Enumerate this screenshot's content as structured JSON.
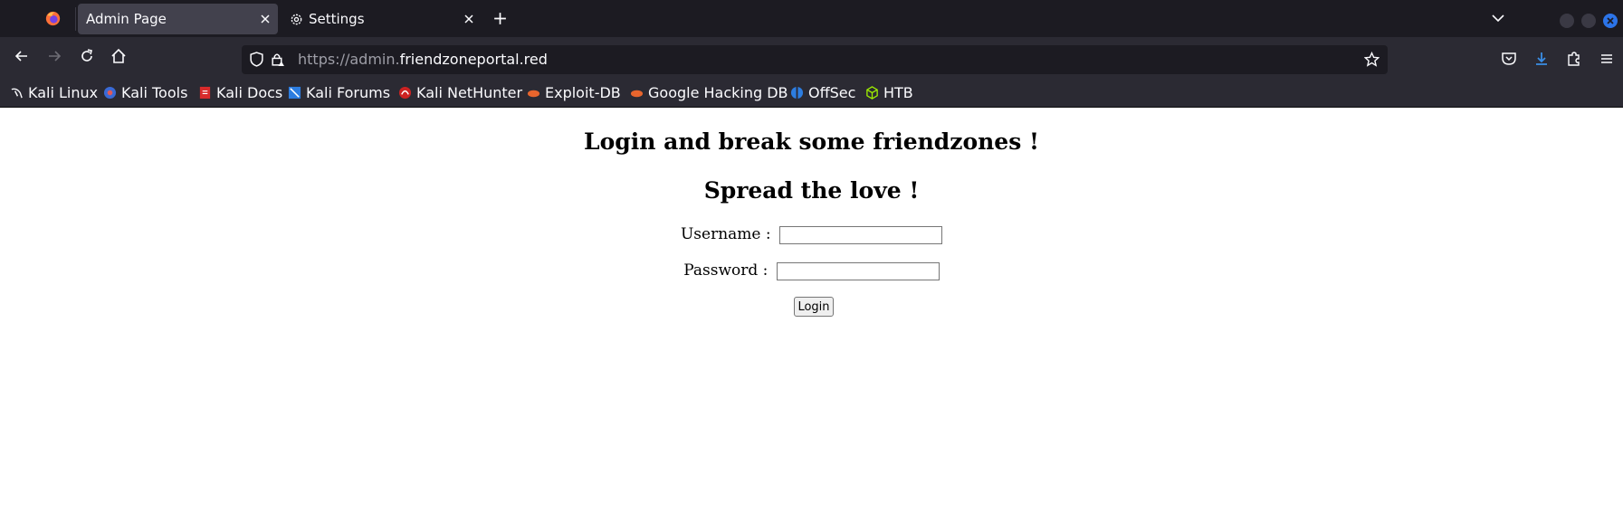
{
  "browser": {
    "tabs": [
      {
        "label": "Admin Page",
        "active": true
      },
      {
        "label": "Settings",
        "active": false,
        "icon": "gear-icon"
      }
    ],
    "url": {
      "scheme_sub": "https://admin.",
      "host": "friendzoneportal.red"
    },
    "bookmarks": [
      {
        "label": "Kali Linux",
        "icon": "kali-dragon-icon"
      },
      {
        "label": "Kali Tools",
        "icon": "kali-tools-icon"
      },
      {
        "label": "Kali Docs",
        "icon": "kali-docs-icon"
      },
      {
        "label": "Kali Forums",
        "icon": "kali-forums-icon"
      },
      {
        "label": "Kali NetHunter",
        "icon": "nethunter-icon"
      },
      {
        "label": "Exploit-DB",
        "icon": "exploitdb-icon"
      },
      {
        "label": "Google Hacking DB",
        "icon": "ghdb-icon"
      },
      {
        "label": "OffSec",
        "icon": "offsec-icon"
      },
      {
        "label": "HTB",
        "icon": "htb-cube-icon"
      }
    ],
    "colors": {
      "chrome_dark": "#1c1b22",
      "chrome": "#2b2a33",
      "accent_blue": "#2c74e8"
    }
  },
  "page": {
    "heading1": "Login and break some friendzones !",
    "heading2": "Spread the love !",
    "username_label": "Username :",
    "username_value": "",
    "password_label": "Password :",
    "password_value": "",
    "login_button": "Login"
  }
}
